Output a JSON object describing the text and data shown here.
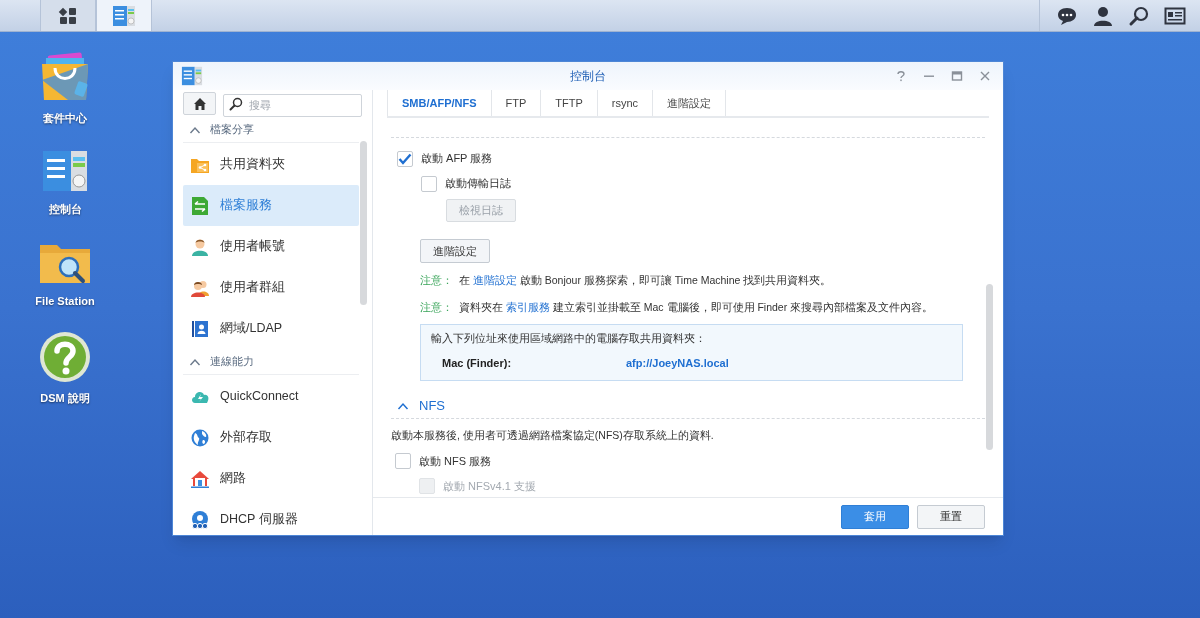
{
  "taskbar": {
    "buttons": [
      {
        "kind": "main-menu",
        "selected": false
      },
      {
        "kind": "control-panel",
        "selected": true
      }
    ],
    "tray": [
      {
        "kind": "chat"
      },
      {
        "kind": "user"
      },
      {
        "kind": "search"
      },
      {
        "kind": "widgets"
      }
    ]
  },
  "desktop_icons": [
    {
      "kind": "package",
      "label": "套件中心"
    },
    {
      "kind": "control-panel",
      "label": "控制台"
    },
    {
      "kind": "file-station",
      "label": "File Station"
    },
    {
      "kind": "help",
      "label": "DSM 說明"
    }
  ],
  "window": {
    "title": "控制台"
  },
  "sidebar": {
    "search": {
      "placeholder": "搜尋"
    },
    "sections": [
      {
        "title": "檔案分享",
        "expanded": true,
        "items": [
          {
            "kind": "shared-folder",
            "label": "共用資料夾",
            "selected": false
          },
          {
            "kind": "file-services",
            "label": "檔案服務",
            "selected": true
          },
          {
            "kind": "user",
            "label": "使用者帳號",
            "selected": false
          },
          {
            "kind": "group",
            "label": "使用者群組",
            "selected": false
          },
          {
            "kind": "ldap",
            "label": "網域/LDAP",
            "selected": false
          }
        ]
      },
      {
        "title": "連線能力",
        "expanded": true,
        "items": [
          {
            "kind": "cloud",
            "label": "QuickConnect",
            "selected": false
          },
          {
            "kind": "globe",
            "label": "外部存取",
            "selected": false
          },
          {
            "kind": "house",
            "label": "網路",
            "selected": false
          },
          {
            "kind": "dhcp",
            "label": "DHCP 伺服器",
            "selected": false
          }
        ]
      }
    ]
  },
  "tabs": [
    {
      "label": "SMB/AFP/NFS",
      "selected": true
    },
    {
      "label": "FTP",
      "selected": false
    },
    {
      "label": "TFTP",
      "selected": false
    },
    {
      "label": "rsync",
      "selected": false
    },
    {
      "label": "進階設定",
      "selected": false
    }
  ],
  "afp": {
    "enable": {
      "label": "啟動 AFP 服務",
      "checked": true
    },
    "transfer_log": {
      "label": "啟動傳輸日誌",
      "checked": false
    },
    "view_log_button": {
      "label": "檢視日誌",
      "disabled": true
    },
    "advanced_button": {
      "label": "進階設定"
    },
    "notes": [
      {
        "label": "注意：",
        "parts": [
          {
            "kind": "text",
            "text": "在 "
          },
          {
            "kind": "link",
            "text": "進階設定"
          },
          {
            "kind": "text",
            "text": " 啟動 Bonjour 服務探索，即可讓 Time Machine 找到共用資料夾。"
          }
        ]
      },
      {
        "label": "注意：",
        "parts": [
          {
            "kind": "text",
            "text": "資料夾在 "
          },
          {
            "kind": "link",
            "text": "索引服務"
          },
          {
            "kind": "text",
            "text": " 建立索引並掛載至 Mac 電腦後，即可使用 Finder 來搜尋內部檔案及文件內容。"
          }
        ]
      }
    ],
    "address_box": {
      "intro": "輸入下列位址來使用區域網路中的電腦存取共用資料夾：",
      "rows": [
        {
          "label": "Mac (Finder):",
          "value": "afp://JoeyNAS.local"
        }
      ]
    }
  },
  "nfs": {
    "title": "NFS",
    "expanded": true,
    "description": "啟動本服務後, 使用者可透過網路檔案協定(NFS)存取系統上的資料.",
    "enable": {
      "label": "啟動 NFS 服務",
      "checked": false,
      "disabled": false
    },
    "v41": {
      "label": "啟動 NFSv4.1 支援",
      "checked": false,
      "disabled": true
    }
  },
  "footer": {
    "buttons": [
      {
        "kind": "primary",
        "label": "套用"
      },
      {
        "kind": "secondary",
        "label": "重置"
      }
    ]
  }
}
